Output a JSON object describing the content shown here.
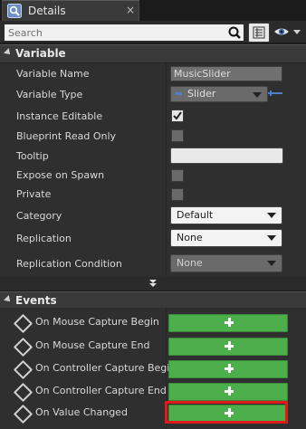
{
  "tab": {
    "title": "Details",
    "icon": "details-search-icon",
    "close": "×"
  },
  "toolbar": {
    "search_placeholder": "Search",
    "search_icon": "magnifier-icon",
    "view_icon": "list-view-icon",
    "eye_icon": "eye-icon"
  },
  "variable_section": {
    "title": "Variable",
    "rows": [
      {
        "label": "Variable Name",
        "value": "MusicSlider"
      },
      {
        "label": "Variable Type",
        "value": "Slider"
      },
      {
        "label": "Instance Editable",
        "checked": true
      },
      {
        "label": "Blueprint Read Only",
        "checked": false
      },
      {
        "label": "Tooltip",
        "value": ""
      },
      {
        "label": "Expose on Spawn",
        "checked": false
      },
      {
        "label": "Private",
        "checked": false
      },
      {
        "label": "Category",
        "value": "Default"
      },
      {
        "label": "Replication",
        "value": "None"
      },
      {
        "label": "Replication Condition",
        "value": "None"
      }
    ]
  },
  "events_section": {
    "title": "Events",
    "rows": [
      {
        "label": "On Mouse Capture Begin"
      },
      {
        "label": "On Mouse Capture End"
      },
      {
        "label": "On Controller Capture Begin"
      },
      {
        "label": "On Controller Capture End"
      },
      {
        "label": "On Value Changed",
        "highlighted": true
      }
    ]
  },
  "colors": {
    "accent_green": "#4caf4c",
    "highlight_red": "#e01a1a",
    "panel": "#2f2f2f",
    "header": "#3a3a3a"
  }
}
